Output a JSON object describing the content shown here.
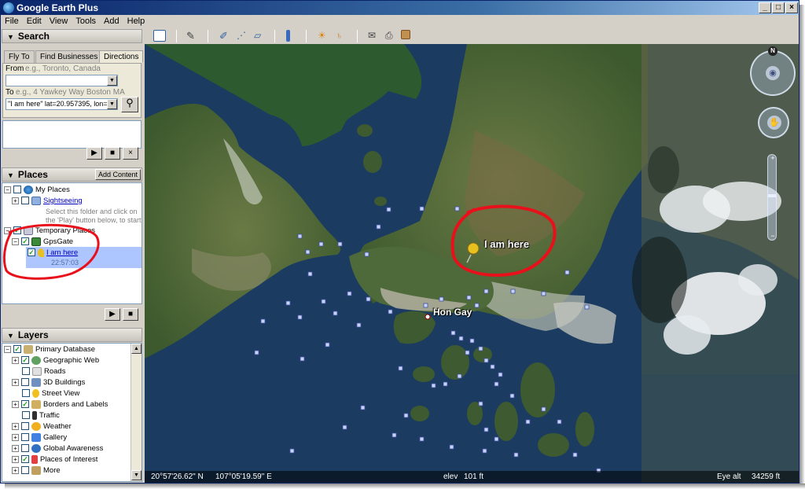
{
  "app": {
    "title": "Google Earth Plus"
  },
  "menu": [
    "File",
    "Edit",
    "View",
    "Tools",
    "Add",
    "Help"
  ],
  "search": {
    "header": "Search",
    "tabs": [
      "Fly To",
      "Find Businesses",
      "Directions"
    ],
    "from_label": "From",
    "from_hint": "e.g., Toronto, Canada",
    "to_label": "To",
    "to_hint": "e.g., 4 Yawkey Way Boston MA",
    "to_value": "\"I am here\" lat=20.957395, lon=107.08",
    "from_value": ""
  },
  "places": {
    "header": "Places",
    "add_content": "Add Content",
    "my_places": "My Places",
    "sightseeing": "Sightseeing",
    "sightseeing_desc1": "Select this folder and click on",
    "sightseeing_desc2": "the 'Play' button below, to start",
    "temporary_places": "Temporary Places",
    "gpsgate": "GpsGate",
    "i_am_here": "I am here",
    "time": "22:57:03"
  },
  "layers": {
    "header": "Layers",
    "items": [
      {
        "label": "Primary Database",
        "checked": true
      },
      {
        "label": "Geographic Web",
        "checked": true
      },
      {
        "label": "Roads",
        "checked": false
      },
      {
        "label": "3D Buildings",
        "checked": false
      },
      {
        "label": "Street View",
        "checked": false
      },
      {
        "label": "Borders and Labels",
        "checked": true
      },
      {
        "label": "Traffic",
        "checked": false
      },
      {
        "label": "Weather",
        "checked": false
      },
      {
        "label": "Gallery",
        "checked": false
      },
      {
        "label": "Global Awareness",
        "checked": false
      },
      {
        "label": "Places of Interest",
        "checked": true
      },
      {
        "label": "More",
        "checked": false
      }
    ]
  },
  "map": {
    "placemark_label": "I am here",
    "city_label": "Hon Gay",
    "compass_n": "N"
  },
  "status": {
    "lat": "20°57'26.62\" N",
    "lon": "107°05'19.59\" E",
    "elev_label": "elev",
    "elev_value": "101 ft",
    "eye_alt_label": "Eye alt",
    "eye_alt_value": "34259 ft"
  },
  "colors": {
    "annotation": "#e8101a",
    "water": "#1a3a5e",
    "land": "#4f6a3a",
    "selection": "#aec6ff"
  }
}
